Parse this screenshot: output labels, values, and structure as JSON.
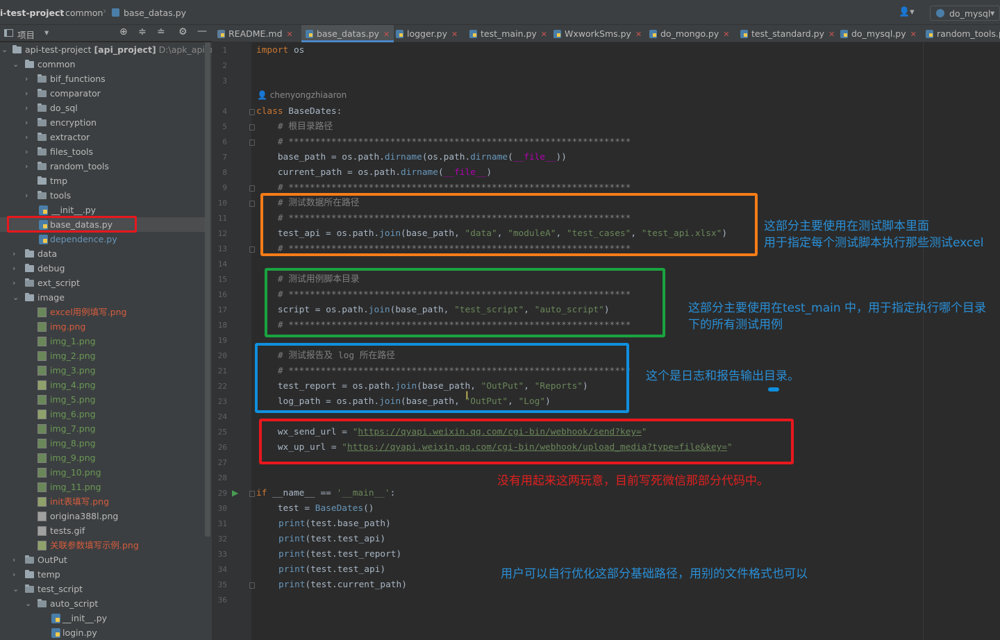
{
  "breadcrumb": {
    "project": "i-test-project",
    "folder": "common",
    "file": "base_datas.py"
  },
  "topbar": {
    "run_config": "do_mysql"
  },
  "sidebar": {
    "title": "项目",
    "rows": [
      {
        "label": "api-test-project",
        "bold": "[api_project]",
        "path": "D:\\apk_api\\api-"
      },
      {
        "label": "common"
      },
      {
        "label": "bif_functions"
      },
      {
        "label": "comparator"
      },
      {
        "label": "do_sql"
      },
      {
        "label": "encryption"
      },
      {
        "label": "extractor"
      },
      {
        "label": "files_tools"
      },
      {
        "label": "random_tools"
      },
      {
        "label": "tmp"
      },
      {
        "label": "tools"
      },
      {
        "label": "__init__.py"
      },
      {
        "label": "base_datas.py"
      },
      {
        "label": "dependence.py"
      },
      {
        "label": "data"
      },
      {
        "label": "debug"
      },
      {
        "label": "ext_script"
      },
      {
        "label": "image"
      },
      {
        "label": "excel用例填写.png"
      },
      {
        "label": "img.png"
      },
      {
        "label": "img_1.png"
      },
      {
        "label": "img_2.png"
      },
      {
        "label": "img_3.png"
      },
      {
        "label": "img_4.png"
      },
      {
        "label": "img_5.png"
      },
      {
        "label": "img_6.png"
      },
      {
        "label": "img_7.png"
      },
      {
        "label": "img_8.png"
      },
      {
        "label": "img_9.png"
      },
      {
        "label": "img_10.png"
      },
      {
        "label": "img_11.png"
      },
      {
        "label": "init表填写.png"
      },
      {
        "label": "origina388l.png"
      },
      {
        "label": "tests.gif"
      },
      {
        "label": "关联参数填写示例.png"
      },
      {
        "label": "OutPut"
      },
      {
        "label": "temp"
      },
      {
        "label": "test_script"
      },
      {
        "label": "auto_script"
      },
      {
        "label": "__init__.py"
      },
      {
        "label": "login.py"
      }
    ]
  },
  "tabs": [
    "README.md",
    "base_datas.py",
    "logger.py",
    "test_main.py",
    "WxworkSms.py",
    "do_mongo.py",
    "test_standard.py",
    "do_mysql.py",
    "random_tools.p"
  ],
  "editor": {
    "author": "chenyongzhiaaron",
    "line_numbers": [
      "1",
      "2",
      "3",
      "4",
      "5",
      "6",
      "7",
      "8",
      "9",
      "10",
      "11",
      "12",
      "13",
      "14",
      "15",
      "16",
      "17",
      "18",
      "19",
      "20",
      "21",
      "22",
      "23",
      "24",
      "25",
      "26",
      "27",
      "28",
      "29",
      "30",
      "31",
      "32",
      "33",
      "34",
      "35",
      "36"
    ],
    "l1_kw": "import",
    "l1_rest": " os",
    "l4_kw": "class",
    "l4_name": " BaseDates",
    "l4_colon": ":",
    "c_root": "    # 根目录路径",
    "c_stars": "    # ****************************************************************",
    "l7_a": "    base_path = os.path.",
    "l7_fn": "dirname",
    "l7_b": "(os.path.",
    "l7_fn2": "dirname",
    "l7_c": "(",
    "l7_d": "__file__",
    "l7_e": "))",
    "l8_a": "    current_path = os.path.",
    "l8_fn": "dirname",
    "l8_b": "(",
    "l8_d": "__file__",
    "l8_e": ")",
    "c_data": "    # 测试数据所在路径",
    "l12_a": "    test_api = os.path.",
    "l12_fn": "join",
    "l12_b": "(base_path, ",
    "l12_s1": "\"data\"",
    "l12_c": ", ",
    "l12_s2": "\"moduleA\"",
    "l12_s3": "\"test_cases\"",
    "l12_s4": "\"test_api.xlsx\"",
    "l12_e": ")",
    "c_script": "    # 测试用例脚本目录",
    "l17_a": "    script = os.path.",
    "l17_fn": "join",
    "l17_b": "(base_path, ",
    "l17_s1": "\"test_script\"",
    "l17_c": ", ",
    "l17_s2": "\"auto_script\"",
    "l17_e": ")",
    "c_report": "    # 测试报告及 log 所在路径",
    "l22_a": "    test_report = os.path.",
    "l22_fn": "join",
    "l22_b": "(base_path, ",
    "l22_s1": "\"OutPut\"",
    "l22_c": ", ",
    "l22_s2": "\"Reports\"",
    "l22_e": ")",
    "l23_a": "    log_path = os.path.",
    "l23_fn": "join",
    "l23_b": "(base_path, ",
    "l23_s1": "\"OutPut\"",
    "l23_c": ", ",
    "l23_s2": "\"Log\"",
    "l23_e": ")",
    "l25_a": "    wx_send_url = ",
    "l25_q": "\"",
    "l25_url": "https://qyapi.weixin.qq.com/cgi-bin/webhook/send?key=",
    "l25_q2": "\"",
    "l26_a": "    wx_up_url = ",
    "l26_url": "https://qyapi.weixin.qq.com/cgi-bin/webhook/upload_media?type=file&key=",
    "l29_kw": "if",
    "l29_a": " __name__ == ",
    "l29_s": "'__main__'",
    "l29_b": ":",
    "l30_a": "    test = ",
    "l30_fn": "BaseDates",
    "l30_b": "()",
    "l31": "(test.base_path)",
    "l32": "(test.test_api)",
    "l33": "(test.test_report)",
    "l34": "(test.test_api)",
    "l35": "(test.current_path)",
    "print_kw": "print"
  },
  "annotations": {
    "orange_1": "这部分主要使用在测试脚本里面",
    "orange_2": "用于指定每个测试脚本执行那些测试excel",
    "green_1": "这部分主要使用在test_main 中，用于指定执行哪个目录",
    "green_2": "下的所有测试用例",
    "blue_1": "这个是日志和报告输出目录。",
    "red_1": "没有用起来这两玩意，目前写死微信那部分代码中。",
    "blue_2": "用户可以自行优化这部分基础路径，用别的文件格式也可以"
  },
  "colors": {
    "orange": "#f57c17",
    "green": "#1aa340",
    "blue": "#0f8fde",
    "red": "#e8181e",
    "note_blue": "#2a8fd6",
    "note_red": "#e02020"
  }
}
